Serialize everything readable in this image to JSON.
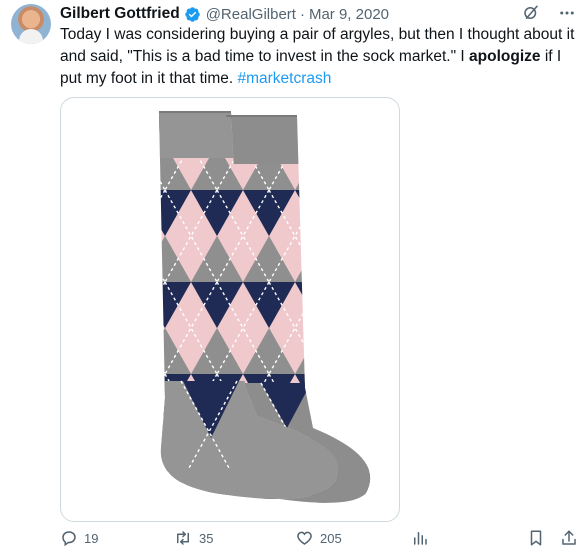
{
  "tweet": {
    "author_name": "Gilbert Gottfried",
    "handle": "@RealGilbert",
    "separator": "·",
    "date": "Mar 9, 2020",
    "text_part1": "Today I was considering buying a pair of argyles, but then I thought about it and said, \"This is a bad time to invest in the sock market.\"  I ",
    "text_bold": "apologize",
    "text_part2": " if I put my foot in it that time.  ",
    "hashtag": "#marketcrash",
    "media_alt": "argyle socks",
    "colors": {
      "link": "#1d9bf0",
      "verified": "#1d9bf0",
      "muted": "#536471"
    }
  },
  "icons": {
    "verified": "verified-badge-icon",
    "grok": "grok-icon",
    "more": "more-icon",
    "reply": "reply-icon",
    "retweet": "retweet-icon",
    "like": "heart-icon",
    "views": "analytics-icon",
    "bookmark": "bookmark-icon",
    "share": "share-icon"
  },
  "actions": {
    "replies": "19",
    "retweets": "35",
    "likes": "205"
  }
}
